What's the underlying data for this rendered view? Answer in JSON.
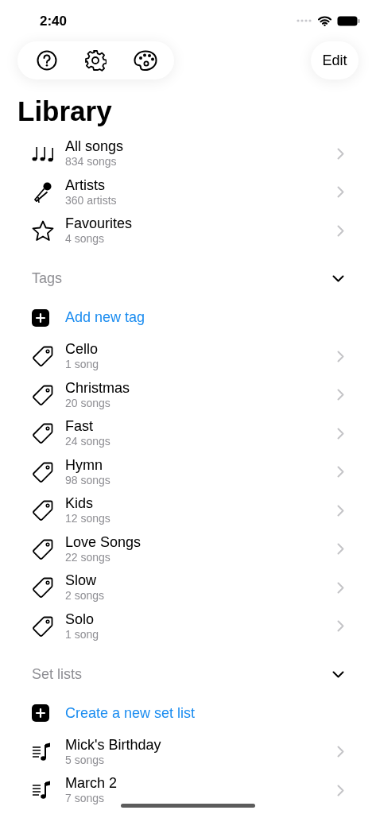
{
  "status_bar": {
    "time": "2:40"
  },
  "toolbar": {
    "edit_button": "Edit"
  },
  "title": "Library",
  "library": [
    {
      "kind": "notes",
      "title": "All songs",
      "subtitle": "834 songs"
    },
    {
      "kind": "mic",
      "title": "Artists",
      "subtitle": "360 artists"
    },
    {
      "kind": "star",
      "title": "Favourites",
      "subtitle": "4 songs"
    }
  ],
  "sections": [
    {
      "kind": "tags",
      "title": "Tags",
      "expanded": true,
      "add_label": "Add new tag",
      "items": [
        {
          "title": "Cello",
          "subtitle": "1 song"
        },
        {
          "title": "Christmas",
          "subtitle": "20 songs"
        },
        {
          "title": "Fast",
          "subtitle": "24 songs"
        },
        {
          "title": "Hymn",
          "subtitle": "98 songs"
        },
        {
          "title": "Kids",
          "subtitle": "12 songs"
        },
        {
          "title": "Love Songs",
          "subtitle": "22 songs"
        },
        {
          "title": "Slow",
          "subtitle": "2 songs"
        },
        {
          "title": "Solo",
          "subtitle": "1 song"
        }
      ]
    },
    {
      "kind": "setlists",
      "title": "Set lists",
      "expanded": true,
      "add_label": "Create a new set list",
      "items": [
        {
          "title": "Mick's Birthday",
          "subtitle": "5 songs"
        },
        {
          "title": "March 2",
          "subtitle": "7 songs"
        }
      ]
    }
  ]
}
